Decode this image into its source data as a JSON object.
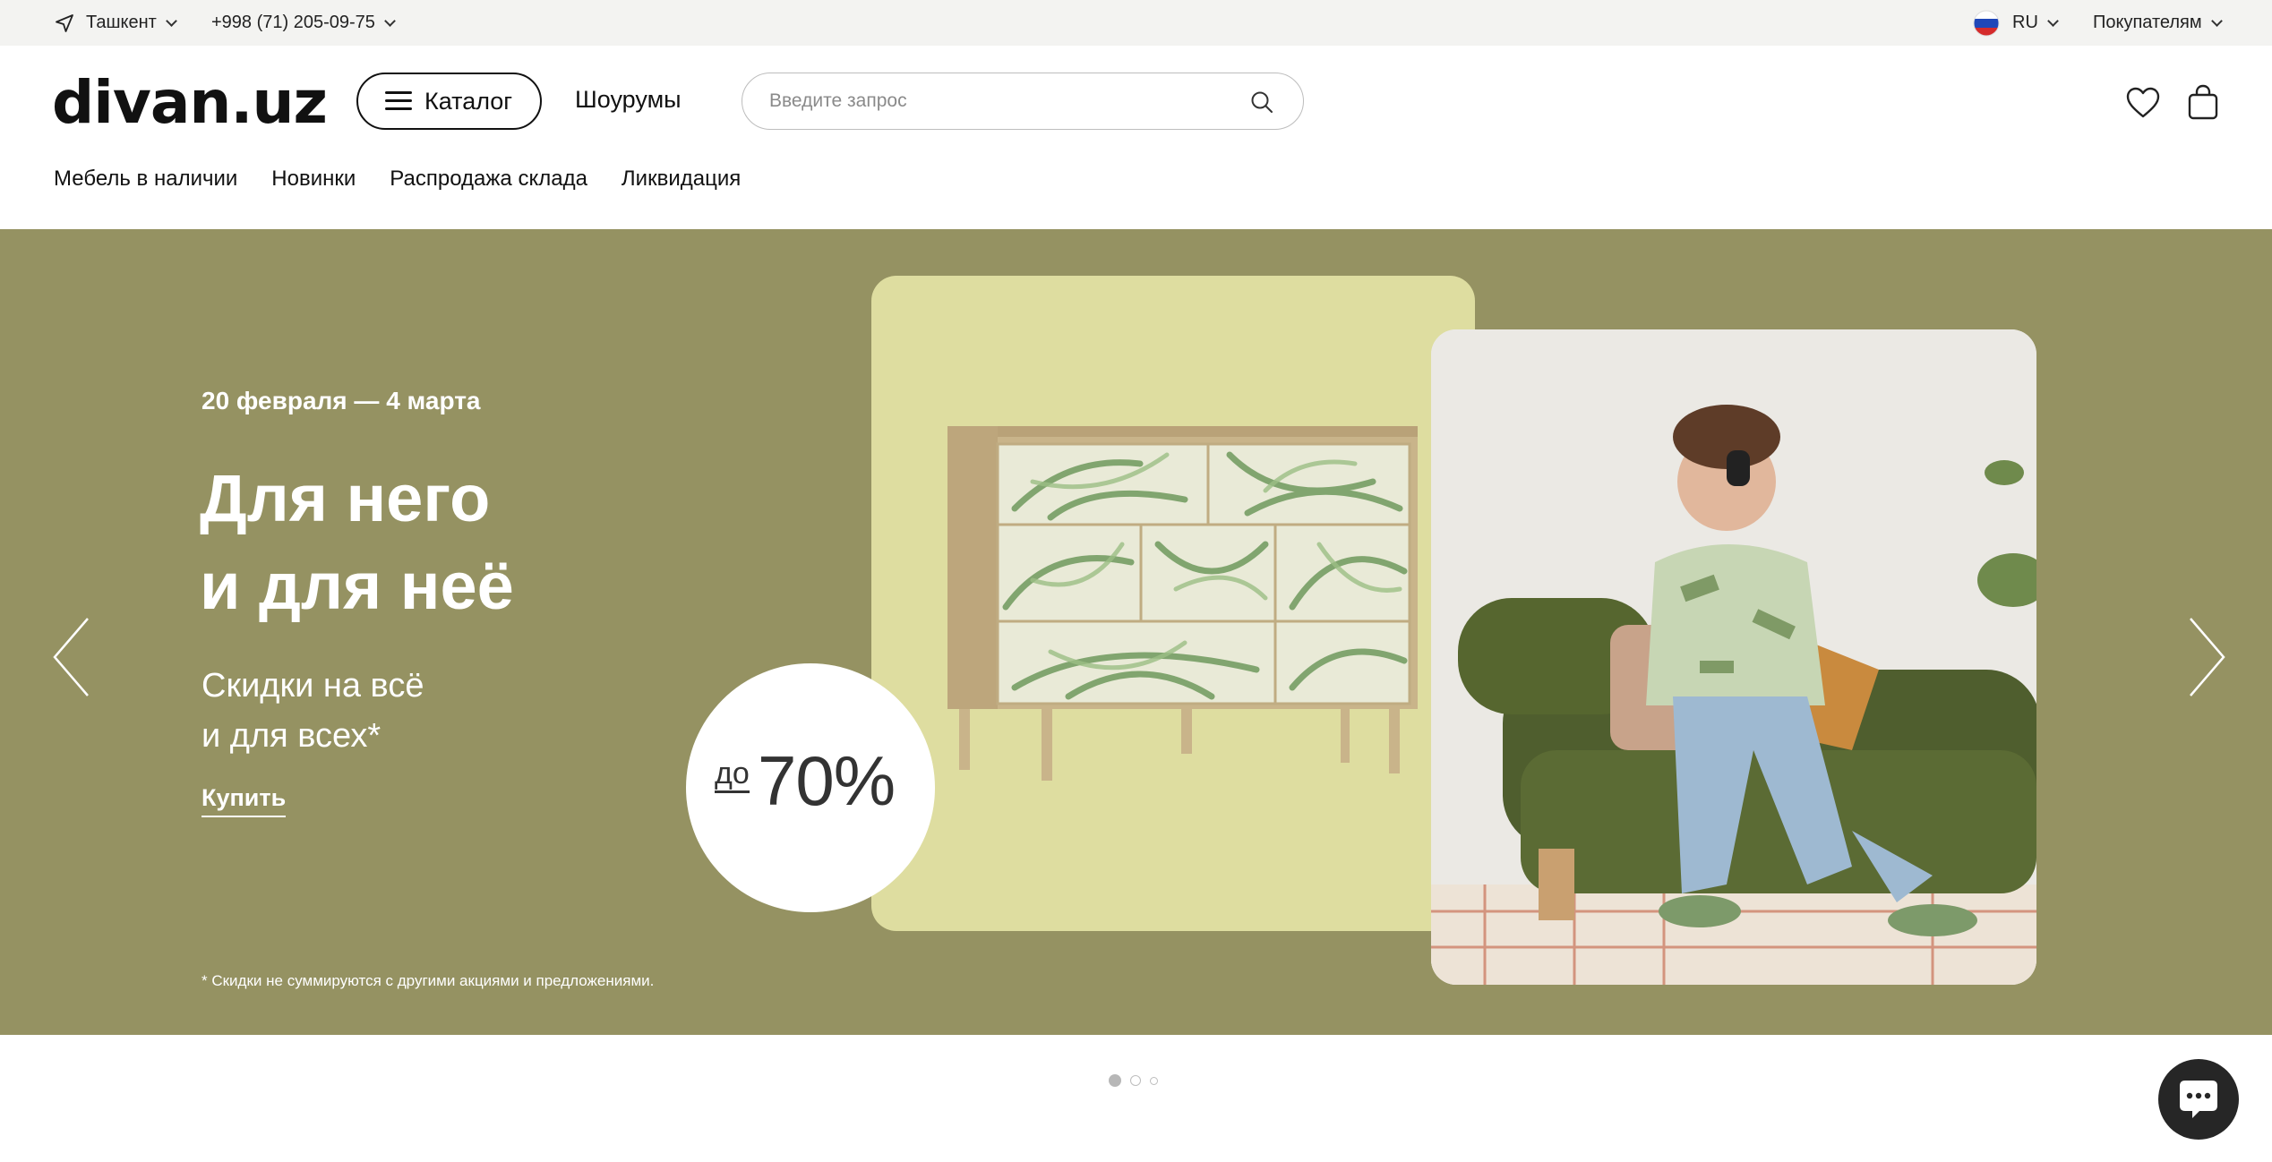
{
  "topbar": {
    "city": "Ташкент",
    "phone": "+998 (71) 205-09-75",
    "language": "RU",
    "buyers_menu": "Покупателям"
  },
  "header": {
    "logo": "divan.uz",
    "catalog_label": "Каталог",
    "showrooms_label": "Шоурумы",
    "search_placeholder": "Введите запрос"
  },
  "nav": {
    "items": [
      {
        "label": "Мебель в наличии"
      },
      {
        "label": "Новинки"
      },
      {
        "label": "Распродажа склада"
      },
      {
        "label": "Ликвидация"
      }
    ]
  },
  "hero": {
    "date": "20 февраля — 4 марта",
    "title_line1": "Для него",
    "title_line2": "и для неё",
    "subtitle_line1": "Скидки на всё",
    "subtitle_line2": "и для всех*",
    "cta": "Купить",
    "discount_prefix": "до",
    "discount_value": "70%",
    "footnote": "* Скидки не суммируются с другими акциями и предложениями.",
    "background_color": "#959262",
    "card_color": "#dedda0"
  },
  "carousel": {
    "slide_count": 3,
    "active_slide": 1
  },
  "icons": {
    "location": "location-arrow-icon",
    "flag": "russia-flag-icon",
    "search": "search-icon",
    "favorites": "heart-icon",
    "cart": "shopping-bag-icon",
    "prev": "chevron-left-icon",
    "next": "chevron-right-icon",
    "chat": "chat-bubble-icon"
  }
}
